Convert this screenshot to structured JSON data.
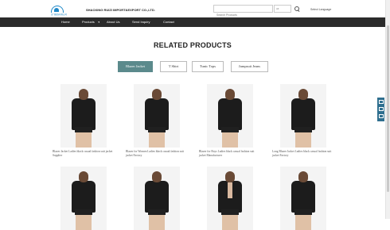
{
  "header": {
    "logo_sub": "金飞服饰有限公司",
    "company_name": "SHAOXING RUIZI IMPORT&EXPORT CO.,LTD.",
    "search_placeholder": "Search Products",
    "search_select": "All",
    "language_label": "Select Language"
  },
  "nav": {
    "items": [
      {
        "label": "Home"
      },
      {
        "label": "Products",
        "has_dropdown": true
      },
      {
        "label": "About Us"
      },
      {
        "label": "Send Inquiry"
      },
      {
        "label": "Contact"
      }
    ]
  },
  "main": {
    "heading": "RELATED PRODUCTS",
    "tabs": [
      {
        "label": "Blazer Jacket",
        "active": true
      },
      {
        "label": "T Shirt",
        "active": false
      },
      {
        "label": "Tunic Tops",
        "active": false
      },
      {
        "label": "Jumpsuit Jeans",
        "active": false
      }
    ],
    "products": [
      {
        "title": "Blazer Jacket Ladies black casual fashion suit jacket Supplier"
      },
      {
        "title": "Blazer for Women Ladies black casual fashion suit jacket Factory"
      },
      {
        "title": "Blazer for Boys Ladies black casual fashion suit jacket Manufacturer"
      },
      {
        "title": "Long Blazer Jacket Ladies black casual fashion suit jacket Factory"
      }
    ]
  },
  "colors": {
    "nav_bg": "#2b2b2b",
    "tab_active_bg": "#5b8a8c",
    "side_widget_bg": "#2f6f8f"
  }
}
